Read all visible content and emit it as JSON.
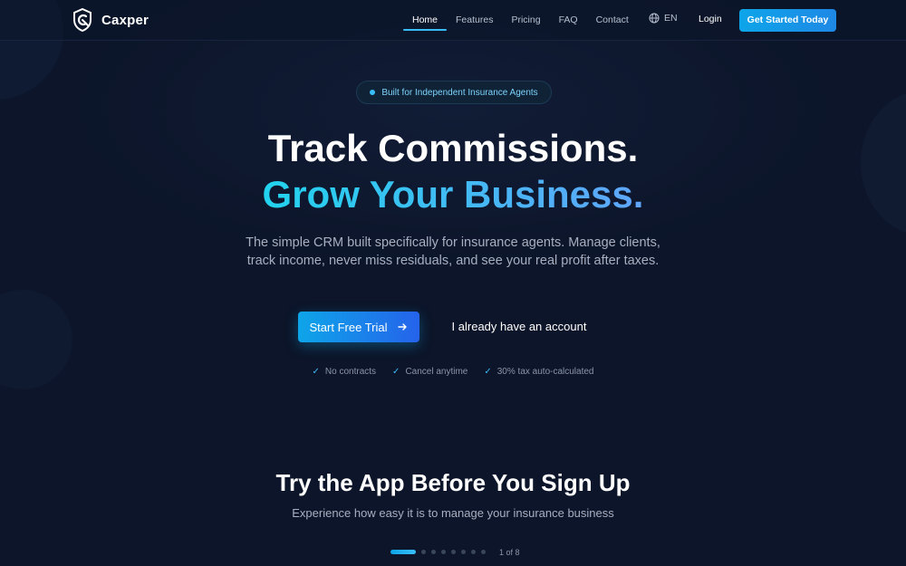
{
  "nav": {
    "brand": "Caxper",
    "links": [
      {
        "label": "Home",
        "active": true
      },
      {
        "label": "Features",
        "active": false
      },
      {
        "label": "Pricing",
        "active": false
      },
      {
        "label": "FAQ",
        "active": false
      },
      {
        "label": "Contact",
        "active": false
      }
    ],
    "language": "EN",
    "login": "Login",
    "cta": "Get Started Today"
  },
  "hero": {
    "badge": "Built for Independent Insurance Agents",
    "headline_line1": "Track Commissions.",
    "headline_line2": "Grow Your Business.",
    "subtitle": "The simple CRM built specifically for insurance agents. Manage clients, track income, never miss residuals, and see your real profit after taxes.",
    "primary_button": "Start Free Trial",
    "primary_button_icon": "arrow-right-icon",
    "secondary_button": "I already have an account",
    "checks": [
      "No contracts",
      "Cancel anytime",
      "30% tax auto-calculated"
    ]
  },
  "demo": {
    "title": "Try the App Before You Sign Up",
    "subtitle": "Experience how easy it is to manage your insurance business",
    "slide_total": 8,
    "slide_current": 1,
    "counter": "1 of 8"
  },
  "colors": {
    "background": "#0c1529",
    "accent": "#0ea5e9",
    "accent_light": "#38bdf8"
  }
}
